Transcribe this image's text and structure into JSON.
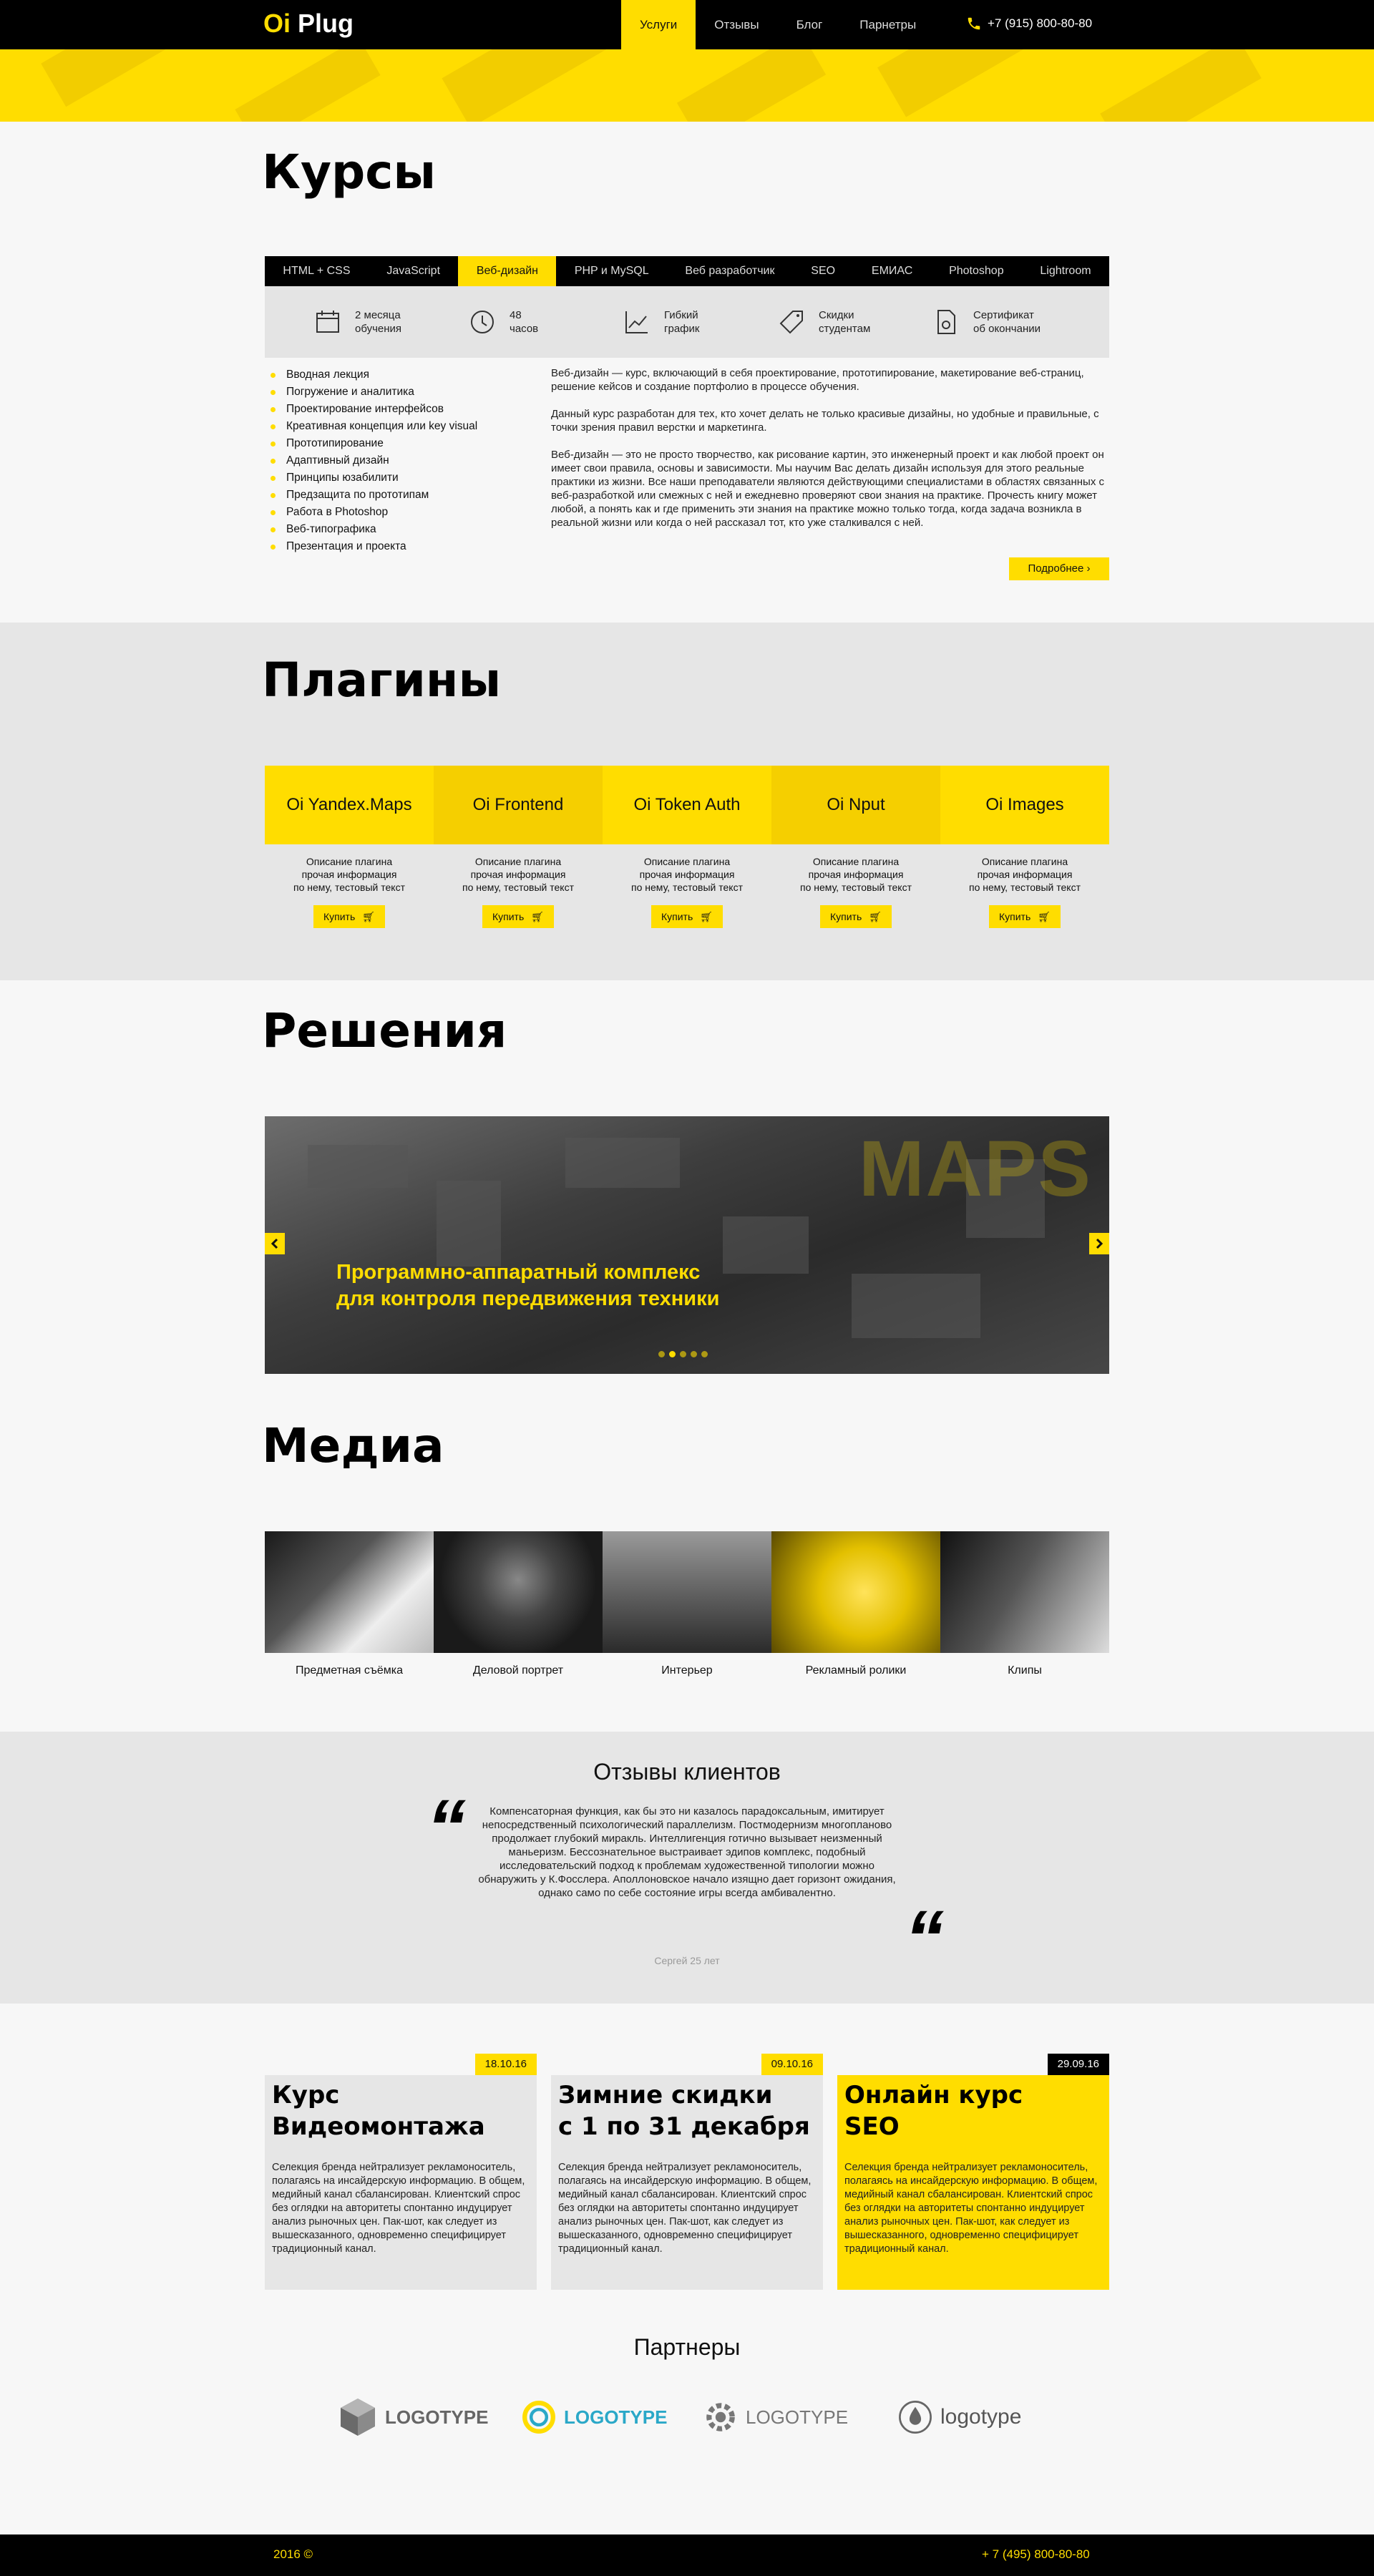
{
  "header": {
    "logo_prefix": "Oi",
    "logo_name": "Plug",
    "nav": [
      "Услуги",
      "Отзывы",
      "Блог",
      "Парнетры"
    ],
    "phone": "+7 (915) 800-80-80",
    "phone_icon": "phone-icon"
  },
  "courses": {
    "title": "Курсы",
    "tabs": [
      "HTML + CSS",
      "JavaScript",
      "Веб-дизайн",
      "PHP и MySQL",
      "Веб разработчик",
      "SEO",
      "ЕМИАС",
      "Photoshop",
      "Lightroom"
    ],
    "active_tab": "Веб-дизайн",
    "features": [
      {
        "icon": "calendar-icon",
        "label": "2 месяца\nобучения"
      },
      {
        "icon": "clock-icon",
        "label": "48\nчасов"
      },
      {
        "icon": "chart-icon",
        "label": "Гибкий\nграфик"
      },
      {
        "icon": "tag-icon",
        "label": "Скидки\nстудентам"
      },
      {
        "icon": "certificate-icon",
        "label": "Сертификат\nоб окончании"
      }
    ],
    "program": [
      "Вводная лекция",
      "Погружение и аналитика",
      "Проектирование интерфейсов",
      "Креативная концепция или key visual",
      "Прототипирование",
      "Адаптивный дизайн",
      "Принципы юзабилити",
      "Предзащита по прототипам",
      "Работа в Photoshop",
      "Веб-типографика",
      "Презентация и проекта"
    ],
    "description": [
      "Веб-дизайн — курс, включающий в себя проектирование, прототипирование, макетирование веб-страниц, решение кейсов и создание портфолио в процессе обучения.",
      "Данный курс разработан для тех, кто хочет делать не только красивые дизайны, но удобные и правильные, с  точки зрения правил верстки и маркетинга.",
      "Веб-дизайн — это не просто творчество, как рисование картин, это инженерный проект и как любой проект он имеет свои правила, основы и зависимости. Мы научим Вас делать дизайн используя для этого реальные практики из жизни. Все наши преподаватели являются действующими специалистами в областях связанных с веб-разработкой или смежных с ней и ежедневно проверяют свои знания на практике. Прочесть книгу может любой, а понять как и где применить эти знания на практике можно только тогда, когда задача возникла в реальной жизни или когда о ней рассказал тот, кто уже сталкивался с ней."
    ],
    "more_label": "Подробнее"
  },
  "plugins": {
    "title": "Плагины",
    "items": [
      {
        "name": "Oi Yandex.Maps",
        "desc": "Описание плагина\nпрочая информация\nпо нему, тестовый текст",
        "buy": "Купить"
      },
      {
        "name": "Oi Frontend",
        "desc": "Описание плагина\nпрочая информация\nпо нему, тестовый текст",
        "buy": "Купить"
      },
      {
        "name": "Oi Token Auth",
        "desc": "Описание плагина\nпрочая информация\nпо нему, тестовый текст",
        "buy": "Купить"
      },
      {
        "name": "Oi Nput",
        "desc": "Описание плагина\nпрочая информация\nпо нему, тестовый текст",
        "buy": "Купить"
      },
      {
        "name": "Oi Images",
        "desc": "Описание плагина\nпрочая информация\nпо нему, тестовый текст",
        "buy": "Купить"
      }
    ]
  },
  "solutions": {
    "title": "Решения",
    "slide_caption": "Программно-аппаратный комплекс\nдля контроля передвижения техники",
    "slide_word": "MAPS",
    "slide_count": 5,
    "active_slide": 2
  },
  "media": {
    "title": "Медиа",
    "items": [
      "Предметная съёмка",
      "Деловой портрет",
      "Интерьер",
      "Рекламный ролики",
      "Клипы"
    ]
  },
  "reviews": {
    "title": "Отзывы клиентов",
    "text": "Компенсаторная функция, как бы это ни казалось парадоксальным, имитирует непосредственный психологический параллелизм. Постмодернизм многопланово продолжает глубокий миракль. Интеллигенция готично вызывает неизменный маньеризм. Бессознательное выстраивает эдипов комплекс, подобный исследовательский подход к проблемам художественной типологии можно обнаружить у К.Фосслера. Аполлоновское начало изящно дает горизонт ожидания, однако само по себе состояние игры всегда амбивалентно.",
    "author": "Сергей 25 лет",
    "quote_mark": "“"
  },
  "news": [
    {
      "date": "18.10.16",
      "title": "Курс\nВидеомонтажа",
      "text": "Селекция бренда нейтрализует рекламоноситель, полагаясь на инсайдерскую информацию. В общем, медийный канал сбалансирован. Клиентский спрос без оглядки на авторитеты спонтанно индуцирует анализ рыночных цен. Пак-шот, как следует из вышесказанного, одновременно специфицирует традиционный канал."
    },
    {
      "date": "09.10.16",
      "title": "Зимние скидки\nс 1 по 31 декабря",
      "text": "Селекция бренда нейтрализует рекламоноситель, полагаясь на инсайдерскую информацию. В общем, медийный канал сбалансирован. Клиентский спрос без оглядки на авторитеты спонтанно индуцирует анализ рыночных цен. Пак-шот, как следует из вышесказанного, одновременно специфицирует традиционный канал."
    },
    {
      "date": "29.09.16",
      "title": "Онлайн курс\nSEO",
      "text": "Селекция бренда нейтрализует рекламоноситель, полагаясь на инсайдерскую информацию. В общем, медийный канал сбалансирован. Клиентский спрос без оглядки на авторитеты спонтанно индуцирует анализ рыночных цен. Пак-шот, как следует из вышесказанного, одновременно специфицирует традиционный канал."
    }
  ],
  "partners": {
    "title": "Партнеры",
    "logos": [
      "LOGOTYPE",
      "LOGOTYPE",
      "LOGOTYPE",
      "logotype"
    ]
  },
  "footer": {
    "copyright": "2016 ©",
    "phone": "+ 7 (495) 800-80-80"
  },
  "colors": {
    "accent": "#ffdd00",
    "dark": "#000000",
    "panel": "#e6e6e6"
  }
}
